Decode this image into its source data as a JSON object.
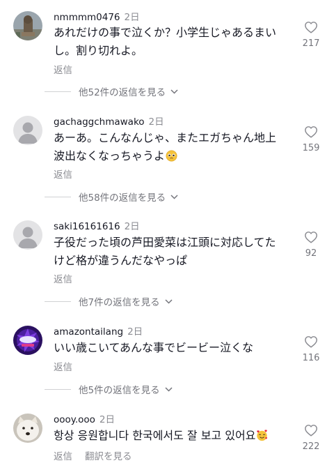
{
  "comments": [
    {
      "username": "nmmmm0476",
      "time": "2日",
      "lines": [
        "あれだけの事で泣くか？小学生じゃあるまい",
        "し。割り切れよ。"
      ],
      "reply_label": "返信",
      "likes": "217",
      "view_replies": "他52件の返信を見る",
      "avatar": "statue-photo"
    },
    {
      "username": "gachaggchmawako",
      "time": "2日",
      "lines": [
        "あーあ。こんなんじゃ、またエガちゃん地上",
        "波出なくなっちゃうよ"
      ],
      "emoji": "pleading-face-emoji",
      "reply_label": "返信",
      "likes": "159",
      "view_replies": "他58件の返信を見る",
      "avatar": "default-user"
    },
    {
      "username": "saki16161616",
      "time": "2日",
      "lines": [
        "子役だった頃の芦田愛菜は江頭に対応してた",
        "けど格が違うんだなやっぱ"
      ],
      "reply_label": "返信",
      "likes": "92",
      "view_replies": "他7件の返信を見る",
      "avatar": "default-user"
    },
    {
      "username": "amazontailang",
      "time": "2日",
      "lines": [
        "いい歳こいてあんな事でビービー泣くな"
      ],
      "reply_label": "返信",
      "likes": "116",
      "view_replies": "他5件の返信を見る",
      "avatar": "purple-logo"
    },
    {
      "username": "oooy.ooo",
      "time": "2日",
      "lines": [
        "항상 응원합니다 한국에서도 잘 보고 있어요"
      ],
      "emoji": "smiling-face-with-hearts-emoji",
      "reply_label": "返信",
      "translate_label": "翻訳を見る",
      "likes": "222",
      "avatar": "dog-photo"
    }
  ],
  "colors": {
    "text_primary": "#161823",
    "text_secondary": "#8a8b91",
    "divider": "#d0d1d3",
    "default_avatar_bg": "#e3e3e5",
    "default_avatar_fg": "#a8a8ad"
  }
}
